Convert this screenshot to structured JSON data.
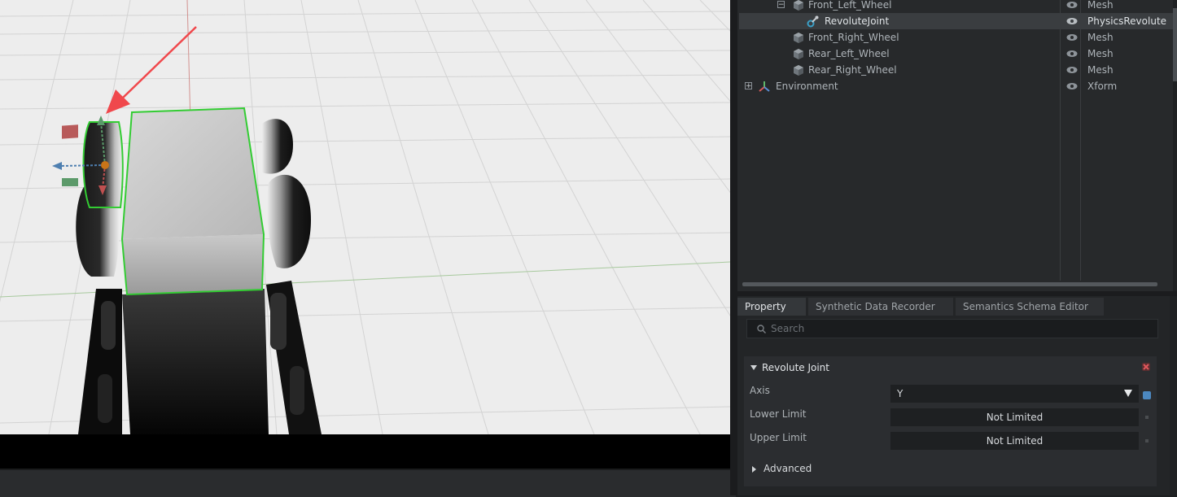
{
  "stage": {
    "rows": [
      {
        "name": "Front_Left_Wheel",
        "type": "Mesh",
        "icon": "cube-icon",
        "expander": "−"
      },
      {
        "name": "RevoluteJoint",
        "type": "PhysicsRevolute",
        "icon": "revolute-joint-icon",
        "selected": true
      },
      {
        "name": "Front_Right_Wheel",
        "type": "Mesh",
        "icon": "cube-icon"
      },
      {
        "name": "Rear_Left_Wheel",
        "type": "Mesh",
        "icon": "cube-icon"
      },
      {
        "name": "Rear_Right_Wheel",
        "type": "Mesh",
        "icon": "cube-icon"
      },
      {
        "name": "Environment",
        "type": "Xform",
        "icon": "xform-icon",
        "expander": "+"
      }
    ]
  },
  "property": {
    "tabs": [
      "Property",
      "Synthetic Data Recorder",
      "Semantics Schema Editor"
    ],
    "search_placeholder": "Search",
    "section_title": "Revolute Joint",
    "axis_label": "Axis",
    "axis_value": "Y",
    "lower_limit_label": "Lower Limit",
    "lower_limit_value": "Not Limited",
    "upper_limit_label": "Upper Limit",
    "upper_limit_value": "Not Limited",
    "advanced_label": "Advanced"
  },
  "colors": {
    "selection_outline": "#33cc33",
    "annotation_arrow": "#f0484c",
    "axis_accent": "#4c88c0"
  }
}
